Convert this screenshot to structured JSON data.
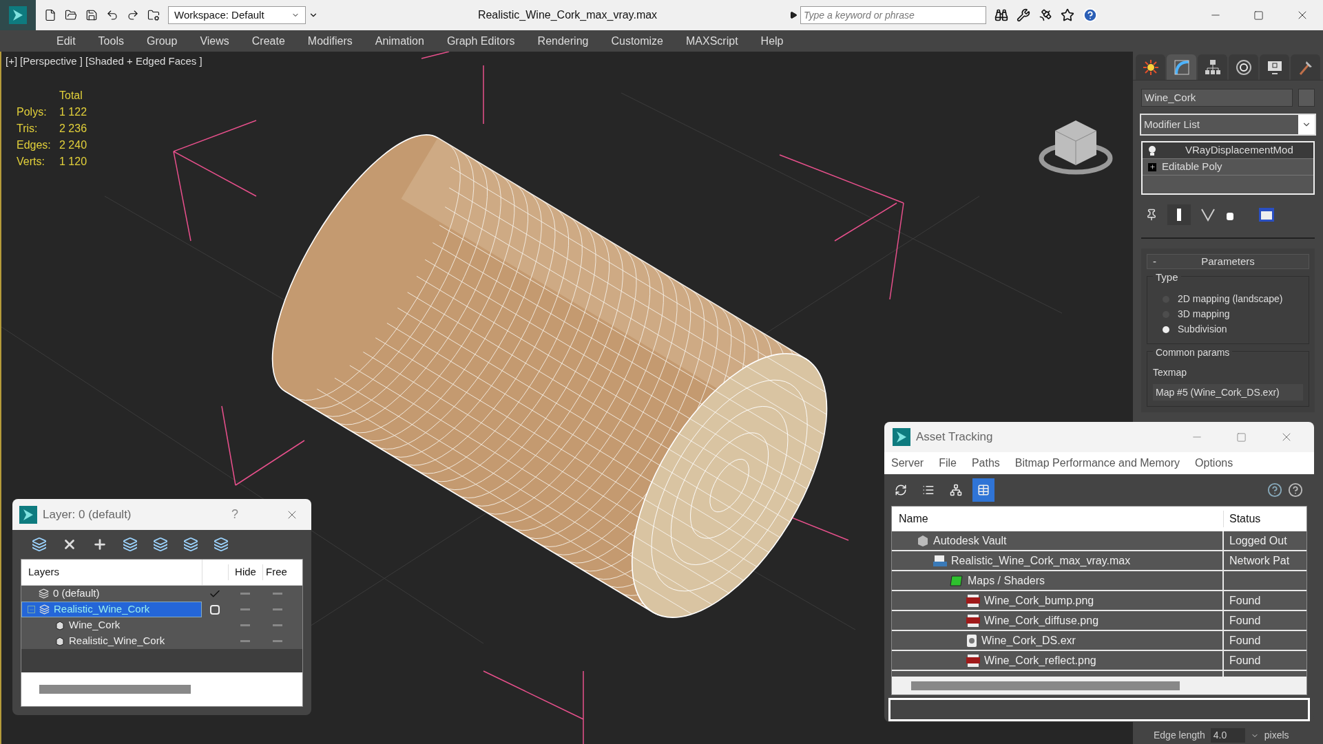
{
  "title_bar": {
    "workspace": "Workspace: Default",
    "title": "Realistic_Wine_Cork_max_vray.max",
    "search": {
      "placeholder": "Type a keyword or phrase"
    }
  },
  "menu": [
    "Edit",
    "Tools",
    "Group",
    "Views",
    "Create",
    "Modifiers",
    "Animation",
    "Graph Editors",
    "Rendering",
    "Customize",
    "MAXScript",
    "Help"
  ],
  "viewport": {
    "labels": [
      "[+]",
      "[Perspective ]",
      "[Shaded + Edged Faces ]"
    ],
    "stats": {
      "header": "Total",
      "rows": [
        {
          "label": "Polys:",
          "value": "1 122"
        },
        {
          "label": "Tris:",
          "value": "2 236"
        },
        {
          "label": "Edges:",
          "value": "2 240"
        },
        {
          "label": "Verts:",
          "value": "1 120"
        }
      ]
    }
  },
  "command_panel": {
    "tabs": [
      {
        "kind": "create",
        "selected": false
      },
      {
        "kind": "modify",
        "selected": true
      },
      {
        "kind": "hierarchy",
        "selected": false
      },
      {
        "kind": "motion",
        "selected": false
      },
      {
        "kind": "display",
        "selected": false
      },
      {
        "kind": "utilities",
        "selected": false
      }
    ],
    "object_name": "Wine_Cork",
    "modifier_list": "Modifier List",
    "stack": [
      {
        "label": "VRayDisplacementMod",
        "kind": "modifier",
        "selected": true
      },
      {
        "label": "Editable Poly",
        "kind": "base",
        "selected": false
      }
    ],
    "parameters": {
      "collapse": "-",
      "title": "Parameters",
      "type_group": "Type",
      "options": [
        {
          "label": "2D mapping (landscape)",
          "selected": false
        },
        {
          "label": "3D mapping",
          "selected": false
        },
        {
          "label": "Subdivision",
          "selected": true
        }
      ],
      "common_group": "Common params",
      "texmap_label": "Texmap",
      "texmap": "Map #5 (Wine_Cork_DS.exr)"
    },
    "edge": {
      "label": "Edge length",
      "value": "4.0",
      "unit": "pixels"
    }
  },
  "layer_dialog": {
    "title": "Layer: 0 (default)",
    "help": "?",
    "columns": [
      "Layers",
      "Hide",
      "Free"
    ],
    "rows": [
      {
        "name": "0 (default)",
        "kind": "layer",
        "active": true,
        "selected": false,
        "children": []
      },
      {
        "name": "Realistic_Wine_Cork",
        "kind": "layer",
        "active": false,
        "selected": true,
        "expanded": true,
        "children": [
          {
            "name": "Wine_Cork",
            "kind": "object",
            "selected": false
          },
          {
            "name": "Realistic_Wine_Cork",
            "kind": "object",
            "selected": false
          }
        ]
      }
    ]
  },
  "asset_tracking": {
    "title": "Asset Tracking",
    "menu": [
      "Server",
      "File",
      "Paths",
      "Bitmap Performance and Memory",
      "Options"
    ],
    "toolbar": [
      {
        "kind": "refresh",
        "selected": false
      },
      {
        "kind": "list",
        "selected": false
      },
      {
        "kind": "tree",
        "selected": false
      },
      {
        "kind": "table",
        "selected": true
      }
    ],
    "columns": [
      "Name",
      "Status"
    ],
    "rows": [
      {
        "name": "Autodesk Vault",
        "kind": "vault",
        "status": "Logged Out",
        "children": [
          {
            "name": "Realistic_Wine_Cork_max_vray.max",
            "kind": "max",
            "status": "Network Pat",
            "children": [
              {
                "name": "Maps / Shaders",
                "kind": "folder",
                "children": [
                  {
                    "name": "Wine_Cork_bump.png",
                    "kind": "png",
                    "status": "Found"
                  },
                  {
                    "name": "Wine_Cork_diffuse.png",
                    "kind": "png",
                    "status": "Found"
                  },
                  {
                    "name": "Wine_Cork_DS.exr",
                    "kind": "exr",
                    "status": "Found"
                  },
                  {
                    "name": "Wine_Cork_reflect.png",
                    "kind": "png",
                    "status": "Found"
                  }
                ]
              }
            ]
          }
        ]
      }
    ]
  }
}
